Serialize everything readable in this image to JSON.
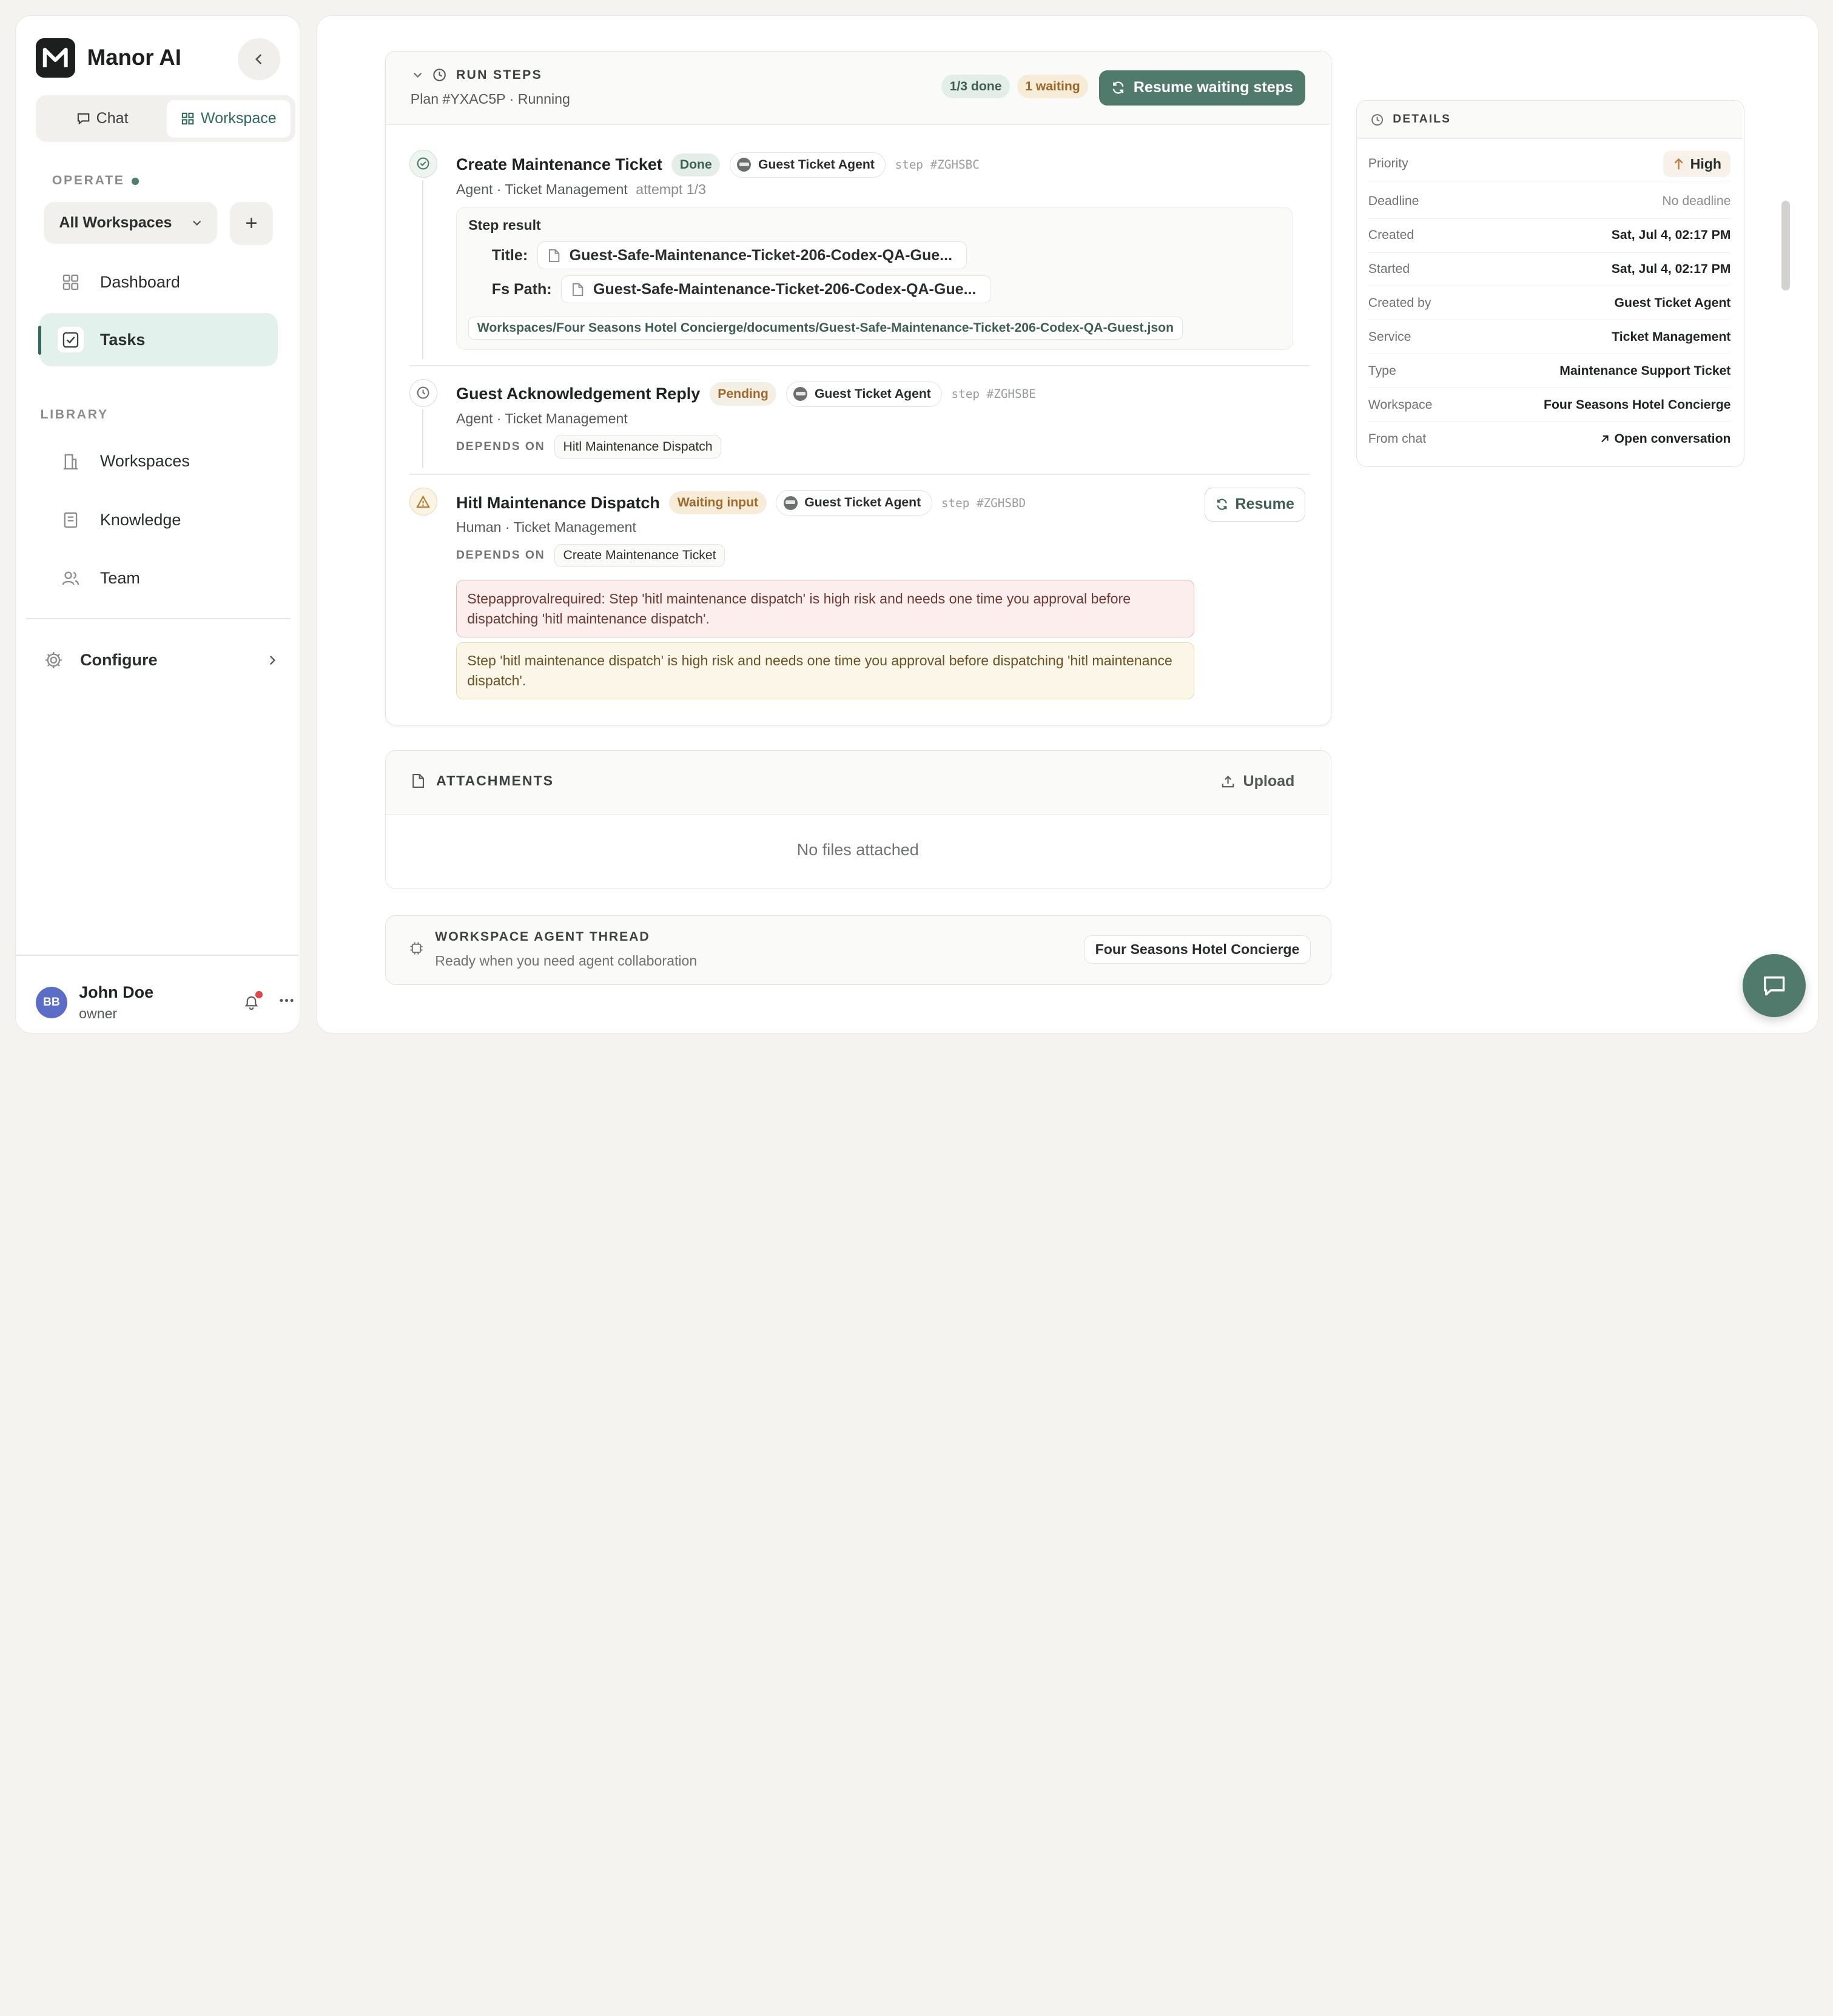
{
  "app": {
    "name": "Manor AI"
  },
  "mode_switch": {
    "chat": "Chat",
    "workspace": "Workspace"
  },
  "sidebar": {
    "operate_label": "OPERATE",
    "workspace_select": "All Workspaces",
    "add_symbol": "+",
    "nav": {
      "dashboard": "Dashboard",
      "tasks": "Tasks"
    },
    "library_label": "LIBRARY",
    "library": {
      "workspaces": "Workspaces",
      "knowledge": "Knowledge",
      "team": "Team"
    },
    "configure": "Configure"
  },
  "user": {
    "initials": "BB",
    "name": "John Doe",
    "role": "owner"
  },
  "run_steps": {
    "title": "RUN STEPS",
    "subtitle": "Plan #YXAC5P · Running",
    "done_pill": "1/3 done",
    "waiting_pill": "1 waiting",
    "resume_all": "Resume waiting steps",
    "steps": [
      {
        "title": "Create Maintenance Ticket",
        "status": "Done",
        "agent": "Guest Ticket Agent",
        "step_id": "step #ZGHSBC",
        "meta": "Agent · Ticket Management",
        "attempt": "attempt 1/3",
        "result_label": "Step result",
        "title_key": "Title:",
        "title_value": "Guest-Safe-Maintenance-Ticket-206-Codex-QA-Gue...",
        "path_key": "Fs Path:",
        "path_value": "Guest-Safe-Maintenance-Ticket-206-Codex-QA-Gue...",
        "full_path": "Workspaces/Four Seasons Hotel Concierge/documents/Guest-Safe-Maintenance-Ticket-206-Codex-QA-Guest.json"
      },
      {
        "title": "Guest Acknowledgement Reply",
        "status": "Pending",
        "agent": "Guest Ticket Agent",
        "step_id": "step #ZGHSBE",
        "meta": "Agent · Ticket Management",
        "depends_label": "DEPENDS ON",
        "depends_on": "Hitl Maintenance Dispatch"
      },
      {
        "title": "Hitl Maintenance Dispatch",
        "status": "Waiting input",
        "agent": "Guest Ticket Agent",
        "step_id": "step #ZGHSBD",
        "meta": "Human · Ticket Management",
        "depends_label": "DEPENDS ON",
        "depends_on": "Create Maintenance Ticket",
        "resume": "Resume",
        "error": "Stepapprovalrequired: Step 'hitl maintenance dispatch' is high risk and needs one time you approval before dispatching 'hitl maintenance dispatch'.",
        "notice": "Step 'hitl maintenance dispatch' is high risk and needs one time you approval before dispatching 'hitl maintenance dispatch'."
      }
    ]
  },
  "attachments": {
    "title": "ATTACHMENTS",
    "upload": "Upload",
    "empty": "No files attached"
  },
  "thread": {
    "title": "WORKSPACE AGENT THREAD",
    "subtitle": "Ready when you need agent collaboration",
    "workspace": "Four Seasons Hotel Concierge"
  },
  "details": {
    "title": "DETAILS",
    "rows": [
      {
        "key": "Priority",
        "value": "High"
      },
      {
        "key": "Deadline",
        "value": "No deadline"
      },
      {
        "key": "Created",
        "value": "Sat, Jul 4, 02:17 PM"
      },
      {
        "key": "Started",
        "value": "Sat, Jul 4, 02:17 PM"
      },
      {
        "key": "Created by",
        "value": "Guest Ticket Agent"
      },
      {
        "key": "Service",
        "value": "Ticket Management"
      },
      {
        "key": "Type",
        "value": "Maintenance Support Ticket"
      },
      {
        "key": "Workspace",
        "value": "Four Seasons Hotel Concierge"
      },
      {
        "key": "From chat",
        "value": "Open conversation"
      }
    ]
  },
  "colors": {
    "accent": "#4f7a6c",
    "active_nav_bg": "#e3f1ec",
    "error_bg": "#fbeeed",
    "notice_bg": "#fbf6e8"
  }
}
